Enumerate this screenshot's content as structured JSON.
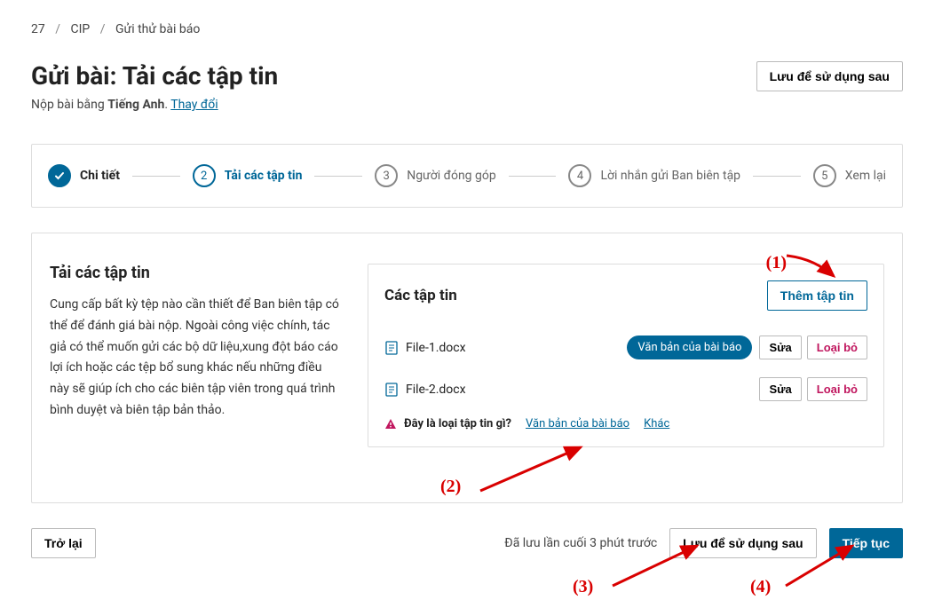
{
  "breadcrumb": {
    "a": "27",
    "b": "CIP",
    "c": "Gửi thử bài báo"
  },
  "page": {
    "title": "Gửi bài: Tải các tập tin",
    "subtitle_prefix": "Nộp bài bằng ",
    "subtitle_lang": "Tiếng Anh",
    "subtitle_dot": ". ",
    "change_link": "Thay đổi",
    "save_later": "Lưu để sử dụng sau"
  },
  "steps": [
    {
      "label": "Chi tiết",
      "state": "done"
    },
    {
      "num": "2",
      "label": "Tải các tập tin",
      "state": "active"
    },
    {
      "num": "3",
      "label": "Người đóng góp",
      "state": ""
    },
    {
      "num": "4",
      "label": "Lời nhắn gửi Ban biên tập",
      "state": ""
    },
    {
      "num": "5",
      "label": "Xem lại",
      "state": ""
    }
  ],
  "upload": {
    "title": "Tải các tập tin",
    "desc": "Cung cấp bất kỳ tệp nào cần thiết để Ban biên tập có thể để đánh giá bài nộp. Ngoài công việc chính, tác giả có thể muốn gửi các bộ dữ liệu,xung đột báo cáo lợi ích hoặc các tệp bổ sung khác nếu những điều này sẽ giúp ích cho các biên tập viên trong quá trình bình duyệt và biên tập bản thảo."
  },
  "files": {
    "header": "Các tập tin",
    "add_button": "Thêm tập tin",
    "items": [
      {
        "name": "File-1.docx",
        "type_badge": "Văn bản của bài báo",
        "edit": "Sửa",
        "remove": "Loại bỏ"
      },
      {
        "name": "File-2.docx",
        "type_badge": "",
        "edit": "Sửa",
        "remove": "Loại bỏ"
      }
    ],
    "warning": {
      "q": "Đây là loại tập tin gì?",
      "link1": "Văn bản của bài báo",
      "link2": "Khác"
    }
  },
  "footer": {
    "back": "Trở lại",
    "saved": "Đã lưu lần cuối 3 phút trước",
    "save_later": "Lưu để sử dụng sau",
    "continue": "Tiếp tục"
  },
  "annotations": {
    "a1": "(1)",
    "a2": "(2)",
    "a3": "(3)",
    "a4": "(4)"
  },
  "icons": {
    "doc": "doc-icon",
    "warn": "warning-icon",
    "check": "check-icon"
  }
}
